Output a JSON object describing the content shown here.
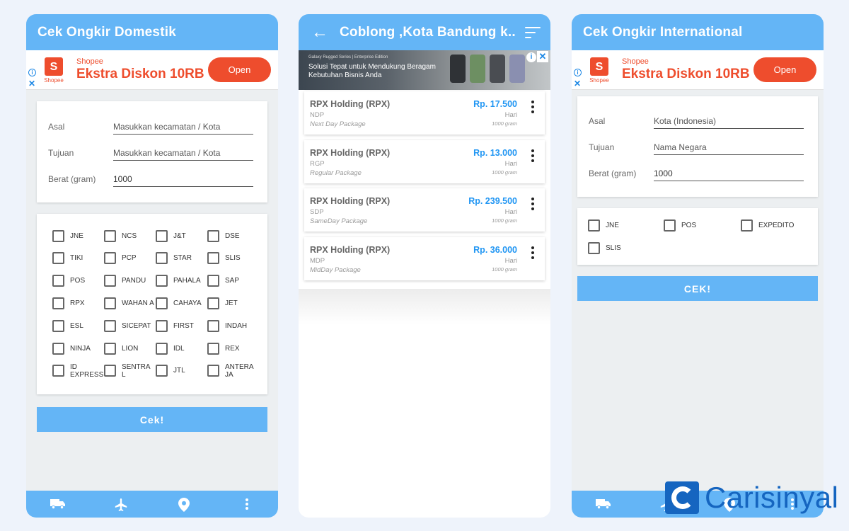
{
  "domestic": {
    "title": "Cek Ongkir Domestik",
    "ad": {
      "brand": "Shopee",
      "logo_caption": "Shopee",
      "headline": "Ekstra Diskon 10RB",
      "open_label": "Open"
    },
    "form": [
      {
        "label": "Asal",
        "value": "",
        "placeholder": "Masukkan kecamatan / Kota"
      },
      {
        "label": "Tujuan",
        "value": "",
        "placeholder": "Masukkan kecamatan / Kota"
      },
      {
        "label": "Berat (gram)",
        "value": "1000",
        "placeholder": ""
      }
    ],
    "couriers": [
      [
        "JNE",
        "NCS",
        "J&T",
        "DSE"
      ],
      [
        "TIKI",
        "PCP",
        "STAR",
        "SLIS"
      ],
      [
        "POS",
        "PANDU",
        "PAHALA",
        "SAP"
      ],
      [
        "RPX",
        "WAHAN A",
        "CAHAYA",
        "JET"
      ],
      [
        "ESL",
        "SICEPAT",
        "FIRST",
        "INDAH"
      ],
      [
        "NINJA",
        "LION",
        "IDL",
        "REX"
      ],
      [
        "ID EXPRESS",
        "SENTRA L",
        "JTL",
        "ANTERA JA"
      ]
    ],
    "button_label": "Cek!",
    "nav_icons": [
      "truck-icon",
      "airplane-icon",
      "location-pin-icon",
      "more-vertical-icon"
    ]
  },
  "results": {
    "title": "Coblong ,Kota Bandung k...",
    "ad": {
      "small_text": "Galaxy Rugged Series | Enterprise Edition",
      "headline": "Solusi Tepat untuk Mendukung Beragam Kebutuhan Bisnis Anda"
    },
    "items": [
      {
        "courier": "RPX Holding (RPX)",
        "code": "NDP",
        "service": "Next Day Package",
        "price": "Rp. 17.500",
        "days": "Hari",
        "weight": "1000 gram"
      },
      {
        "courier": "RPX Holding (RPX)",
        "code": "RGP",
        "service": "Regular Package",
        "price": "Rp. 13.000",
        "days": "Hari",
        "weight": "1000 gram"
      },
      {
        "courier": "RPX Holding (RPX)",
        "code": "SDP",
        "service": "SameDay Package",
        "price": "Rp. 239.500",
        "days": "Hari",
        "weight": "1000 gram"
      },
      {
        "courier": "RPX Holding (RPX)",
        "code": "MDP",
        "service": "MidDay Package",
        "price": "Rp. 36.000",
        "days": "Hari",
        "weight": "1000 gram"
      }
    ]
  },
  "international": {
    "title": "Cek Ongkir International",
    "ad": {
      "brand": "Shopee",
      "logo_caption": "Shopee",
      "headline": "Ekstra Diskon 10RB",
      "open_label": "Open"
    },
    "form": [
      {
        "label": "Asal",
        "value": "",
        "placeholder": "Kota (Indonesia)"
      },
      {
        "label": "Tujuan",
        "value": "",
        "placeholder": "Nama Negara"
      },
      {
        "label": "Berat (gram)",
        "value": "1000",
        "placeholder": ""
      }
    ],
    "couriers": [
      [
        "JNE",
        "POS",
        "EXPEDITO"
      ],
      [
        "SLIS"
      ]
    ],
    "button_label": "CEK!"
  },
  "watermark": "Carisinyal",
  "colors": {
    "appbar": "#64b5f6",
    "price": "#2196f3",
    "shopee": "#ee4d2d",
    "watermark": "#1565c0"
  }
}
